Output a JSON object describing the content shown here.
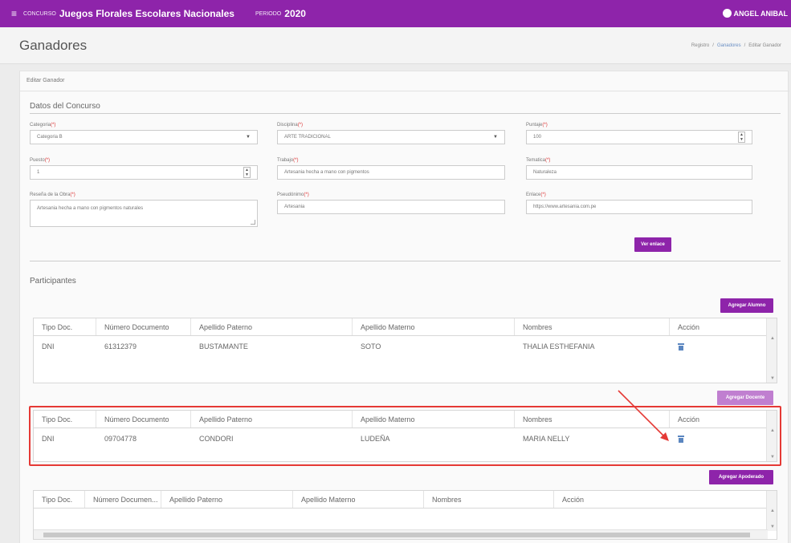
{
  "topbar": {
    "menu_icon": "menu-icon",
    "concurso_label": "CONCURSO",
    "concurso_value": "Juegos Florales Escolares Nacionales",
    "periodo_label": "PERIODO",
    "periodo_value": "2020",
    "user_name": "ANGEL ANIBAL",
    "brand_color": "#8e24aa"
  },
  "page": {
    "title": "Ganadores",
    "breadcrumb": [
      "Registro",
      "Ganadores",
      "Editar Ganador"
    ]
  },
  "card": {
    "title": "Editar Ganador"
  },
  "concurso": {
    "section_title": "Datos del Concurso",
    "categoria": {
      "label": "Categoria",
      "value": "Categoria B"
    },
    "disciplina": {
      "label": "Disciplina",
      "value": "ARTE TRADICIONAL"
    },
    "puntaje": {
      "label": "Puntaje",
      "value": "100"
    },
    "puesto": {
      "label": "Puesto",
      "value": "1"
    },
    "trabajo": {
      "label": "Trabajo",
      "value": "Artesania hecha a mano con pigmentos"
    },
    "tematica": {
      "label": "Tematica",
      "value": "Naturaleza"
    },
    "resena": {
      "label": "Reseña de la Obra",
      "value": "Artesania hecha a mano con pigmentos naturales"
    },
    "seudonimo": {
      "label": "Pseudónimo",
      "value": "Artesania"
    },
    "enlace": {
      "label": "Enlace",
      "value": "https://www.artesania.com.pe"
    },
    "required_mark": "(*)",
    "ver_enlace": "Ver enlace"
  },
  "participantes": {
    "section_title": "Participantes",
    "agregar_alumno": "Agregar Alumno",
    "agregar_docente": "Agregar Docente",
    "agregar_apoderado": "Agregar Apoderado",
    "columns": [
      "Tipo Doc.",
      "Número Documento",
      "Apellido Paterno",
      "Apellido Materno",
      "Nombres",
      "Acción"
    ],
    "columns_apoderado": [
      "Tipo Doc.",
      "Número Documen...",
      "Apellido Paterno",
      "Apellido Materno",
      "Nombres",
      "Acción"
    ],
    "alumnos": [
      {
        "tipo": "DNI",
        "numero": "61312379",
        "paterno": "BUSTAMANTE",
        "materno": "SOTO",
        "nombres": "THALIA ESTHEFANIA",
        "accion_icon": "trash-icon"
      }
    ],
    "docentes": [
      {
        "tipo": "DNI",
        "numero": "09704778",
        "paterno": "CONDORI",
        "materno": "LUDEÑA",
        "nombres": "MARIA NELLY",
        "accion_icon": "trash-icon"
      }
    ]
  },
  "annotation": {
    "highlight_color": "#e53935"
  }
}
